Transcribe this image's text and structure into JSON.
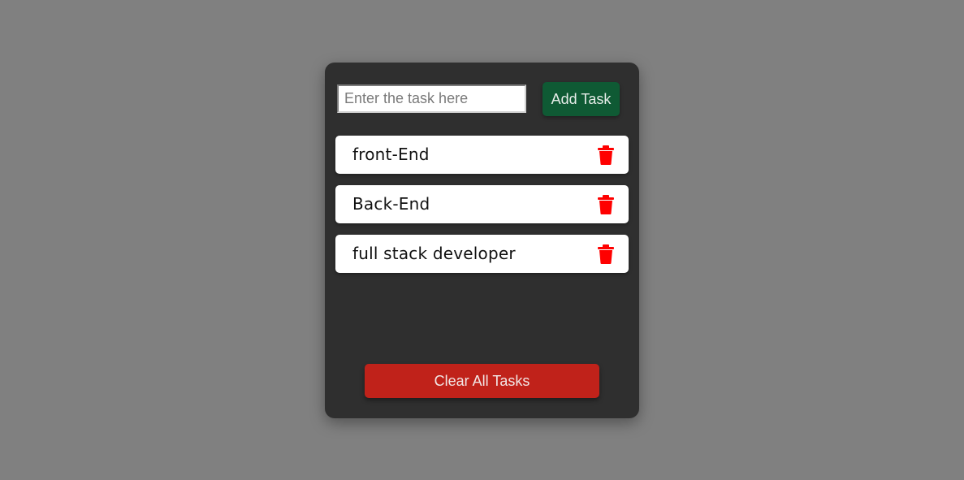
{
  "input": {
    "placeholder": "Enter the task here",
    "value": ""
  },
  "add_button": {
    "label": "Add Task",
    "color": "#0f5a34"
  },
  "tasks": [
    {
      "text": "front-End",
      "delete_icon": "trash-icon"
    },
    {
      "text": "Back-End",
      "delete_icon": "trash-icon"
    },
    {
      "text": "full stack developer",
      "delete_icon": "trash-icon"
    }
  ],
  "clear_button": {
    "label": "Clear All Tasks",
    "color": "#c0221a"
  },
  "colors": {
    "page_background": "#808080",
    "card_background": "#2f2f2f",
    "delete_icon": "#ff0000"
  }
}
